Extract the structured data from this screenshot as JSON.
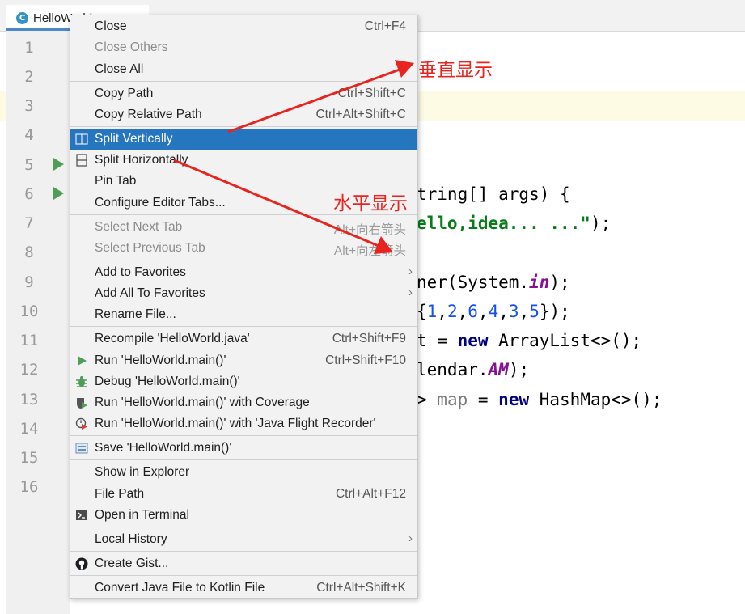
{
  "tab": {
    "title": "HelloWorld"
  },
  "gutter": {
    "lines": [
      "1",
      "2",
      "3",
      "4",
      "5",
      "6",
      "7",
      "8",
      "9",
      "10",
      "11",
      "12",
      "13",
      "14",
      "15",
      "16"
    ]
  },
  "code": {
    "l5": "tring[] args) {",
    "l6_str": "ello,idea... ...\"",
    "l6_end": ");",
    "l9a": "ner(System.",
    "l9b": "in",
    "l9c": ");",
    "l10a": "{",
    "l10n": [
      "1",
      "2",
      "6",
      "4",
      "3",
      "5"
    ],
    "l10b": "});",
    "l11a": "t = ",
    "l11kw": "new",
    "l11b": " ArrayList<>();",
    "l12a": "lendar.",
    "l12b": "AM",
    "l12c": ");",
    "l13a": "> ",
    "l13dim": "map",
    "l13b": " = ",
    "l13kw": "new",
    "l13c": " HashMap<>();"
  },
  "menu": {
    "close": {
      "label": "Close",
      "shortcut": "Ctrl+F4"
    },
    "close_others": {
      "label": "Close Others"
    },
    "close_all": {
      "label": "Close All"
    },
    "copy_path": {
      "label": "Copy Path",
      "shortcut": "Ctrl+Shift+C"
    },
    "copy_relative_path": {
      "label": "Copy Relative Path",
      "shortcut": "Ctrl+Alt+Shift+C"
    },
    "split_vertically": {
      "label": "Split Vertically"
    },
    "split_horizontally": {
      "label": "Split Horizontally"
    },
    "pin_tab": {
      "label": "Pin Tab"
    },
    "configure_editor_tabs": {
      "label": "Configure Editor Tabs..."
    },
    "select_next_tab": {
      "label": "Select Next Tab",
      "shortcut": "Alt+向右箭头"
    },
    "select_previous_tab": {
      "label": "Select Previous Tab",
      "shortcut": "Alt+向左箭头"
    },
    "add_to_favorites": {
      "label": "Add to Favorites"
    },
    "add_all_to_favorites": {
      "label": "Add All To Favorites"
    },
    "rename_file": {
      "label": "Rename File..."
    },
    "recompile": {
      "label": "Recompile 'HelloWorld.java'",
      "shortcut": "Ctrl+Shift+F9"
    },
    "run": {
      "label": "Run 'HelloWorld.main()'",
      "shortcut": "Ctrl+Shift+F10"
    },
    "debug": {
      "label": "Debug 'HelloWorld.main()'"
    },
    "run_coverage": {
      "label": "Run 'HelloWorld.main()' with Coverage"
    },
    "run_jfr": {
      "label": "Run 'HelloWorld.main()' with 'Java Flight Recorder'"
    },
    "save": {
      "label": "Save 'HelloWorld.main()'"
    },
    "show_in_explorer": {
      "label": "Show in Explorer"
    },
    "file_path": {
      "label": "File Path",
      "shortcut": "Ctrl+Alt+F12"
    },
    "open_in_terminal": {
      "label": "Open in Terminal"
    },
    "local_history": {
      "label": "Local History"
    },
    "create_gist": {
      "label": "Create Gist..."
    },
    "convert_kotlin": {
      "label": "Convert Java File to Kotlin File",
      "shortcut": "Ctrl+Alt+Shift+K"
    },
    "submenu_arrow": "›"
  },
  "annotations": {
    "vertical": "垂直显示",
    "horizontal": "水平显示",
    "color": "#e8241e"
  },
  "colors": {
    "selection": "#2675bf",
    "run_icon": "#4e9e56",
    "keyword": "#000080",
    "string": "#067d17",
    "number": "#1750eb"
  }
}
